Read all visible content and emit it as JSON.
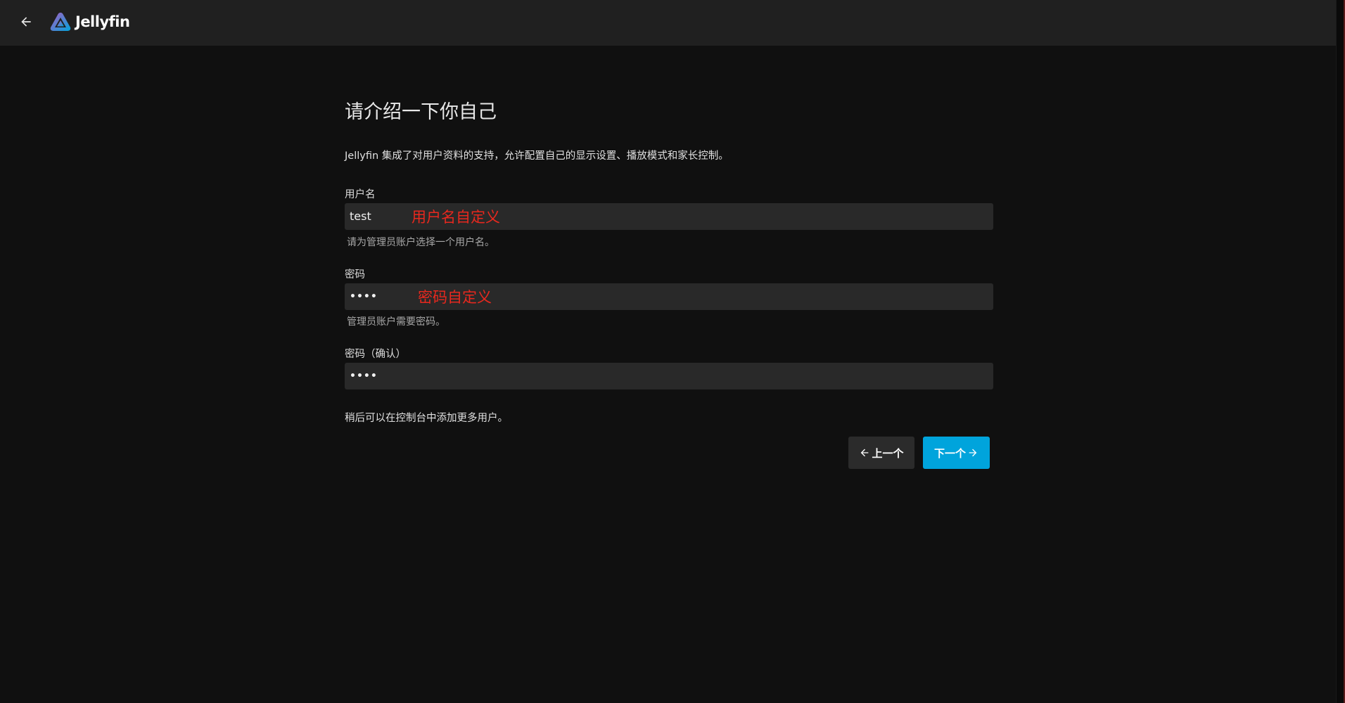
{
  "header": {
    "back_icon": "arrow-left-icon",
    "logo_text": "Jellyfin",
    "logo_icon": "jellyfin-triangle-icon"
  },
  "wizard": {
    "title": "请介绍一下你自己",
    "description": "Jellyfin 集成了对用户资料的支持，允许配置自己的显示设置、播放模式和家长控制。",
    "username": {
      "label": "用户名",
      "value": "test",
      "annotation": "用户名自定义",
      "hint": "请为管理员账户选择一个用户名。"
    },
    "password": {
      "label": "密码",
      "value": "••••",
      "annotation": "密码自定义",
      "hint": "管理员账户需要密码。"
    },
    "password_confirm": {
      "label": "密码（确认）",
      "value": "••••"
    },
    "footer_note": "稍后可以在控制台中添加更多用户。",
    "buttons": {
      "prev_label": "上一个",
      "next_label": "下一个"
    }
  },
  "colors": {
    "background": "#101010",
    "header": "#202020",
    "input": "#292929",
    "accent": "#00a4dc",
    "annotation": "#e8281e"
  }
}
